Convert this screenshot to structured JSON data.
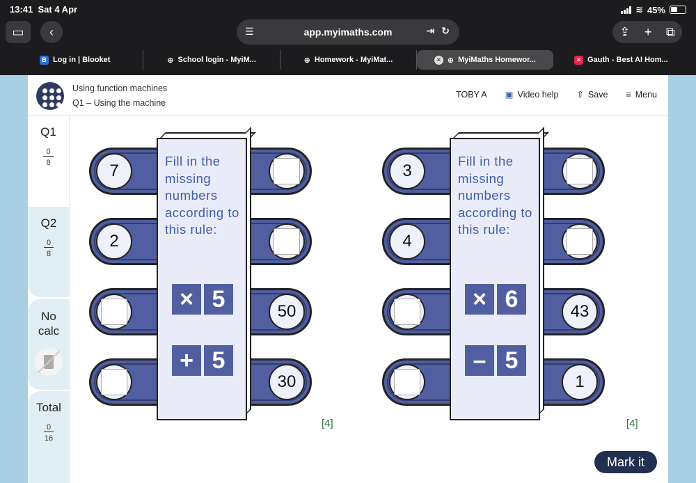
{
  "status": {
    "time": "13:41",
    "date": "Sat 4 Apr",
    "battery": "45%"
  },
  "browser": {
    "url": "app.myimaths.com",
    "tabs": [
      {
        "label": "Log in | Blooket",
        "icon": "blooket-icon",
        "color": "#2b6fd6"
      },
      {
        "label": "School login - MyiM...",
        "icon": "globe-icon",
        "color": ""
      },
      {
        "label": "Homework - MyiMat...",
        "icon": "globe-icon",
        "color": ""
      },
      {
        "label": "MyiMaths Homewor...",
        "icon": "globe-icon",
        "color": "",
        "active": true
      },
      {
        "label": "Gauth - Best AI Hom...",
        "icon": "gauth-icon",
        "color": "#e0284a"
      }
    ]
  },
  "header": {
    "title": "Using function machines",
    "subtitle": "Q1 – Using the machine",
    "user": "TOBY A",
    "video_help": "Video help",
    "save": "Save",
    "menu": "Menu"
  },
  "sidebar": {
    "q1": {
      "label": "Q1",
      "score": "0",
      "total": "8"
    },
    "q2": {
      "label": "Q2",
      "score": "0",
      "total": "8"
    },
    "calc": {
      "label": "No calc"
    },
    "total": {
      "label": "Total",
      "score": "0",
      "total": "16"
    }
  },
  "machines": [
    {
      "rule_text": "Fill in the missing numbers according to this rule:",
      "op1_sym": "×",
      "op1_val": "5",
      "op2_sym": "+",
      "op2_val": "5",
      "rows": [
        {
          "input": "7",
          "output": ""
        },
        {
          "input": "2",
          "output": ""
        },
        {
          "input": "",
          "output": "50"
        },
        {
          "input": "",
          "output": "30"
        }
      ],
      "marks": "[4]"
    },
    {
      "rule_text": "Fill in the missing numbers according to this rule:",
      "op1_sym": "×",
      "op1_val": "6",
      "op2_sym": "–",
      "op2_val": "5",
      "rows": [
        {
          "input": "3",
          "output": ""
        },
        {
          "input": "4",
          "output": ""
        },
        {
          "input": "",
          "output": "43"
        },
        {
          "input": "",
          "output": "1"
        }
      ],
      "marks": "[4]"
    }
  ],
  "mark_button": "Mark it"
}
